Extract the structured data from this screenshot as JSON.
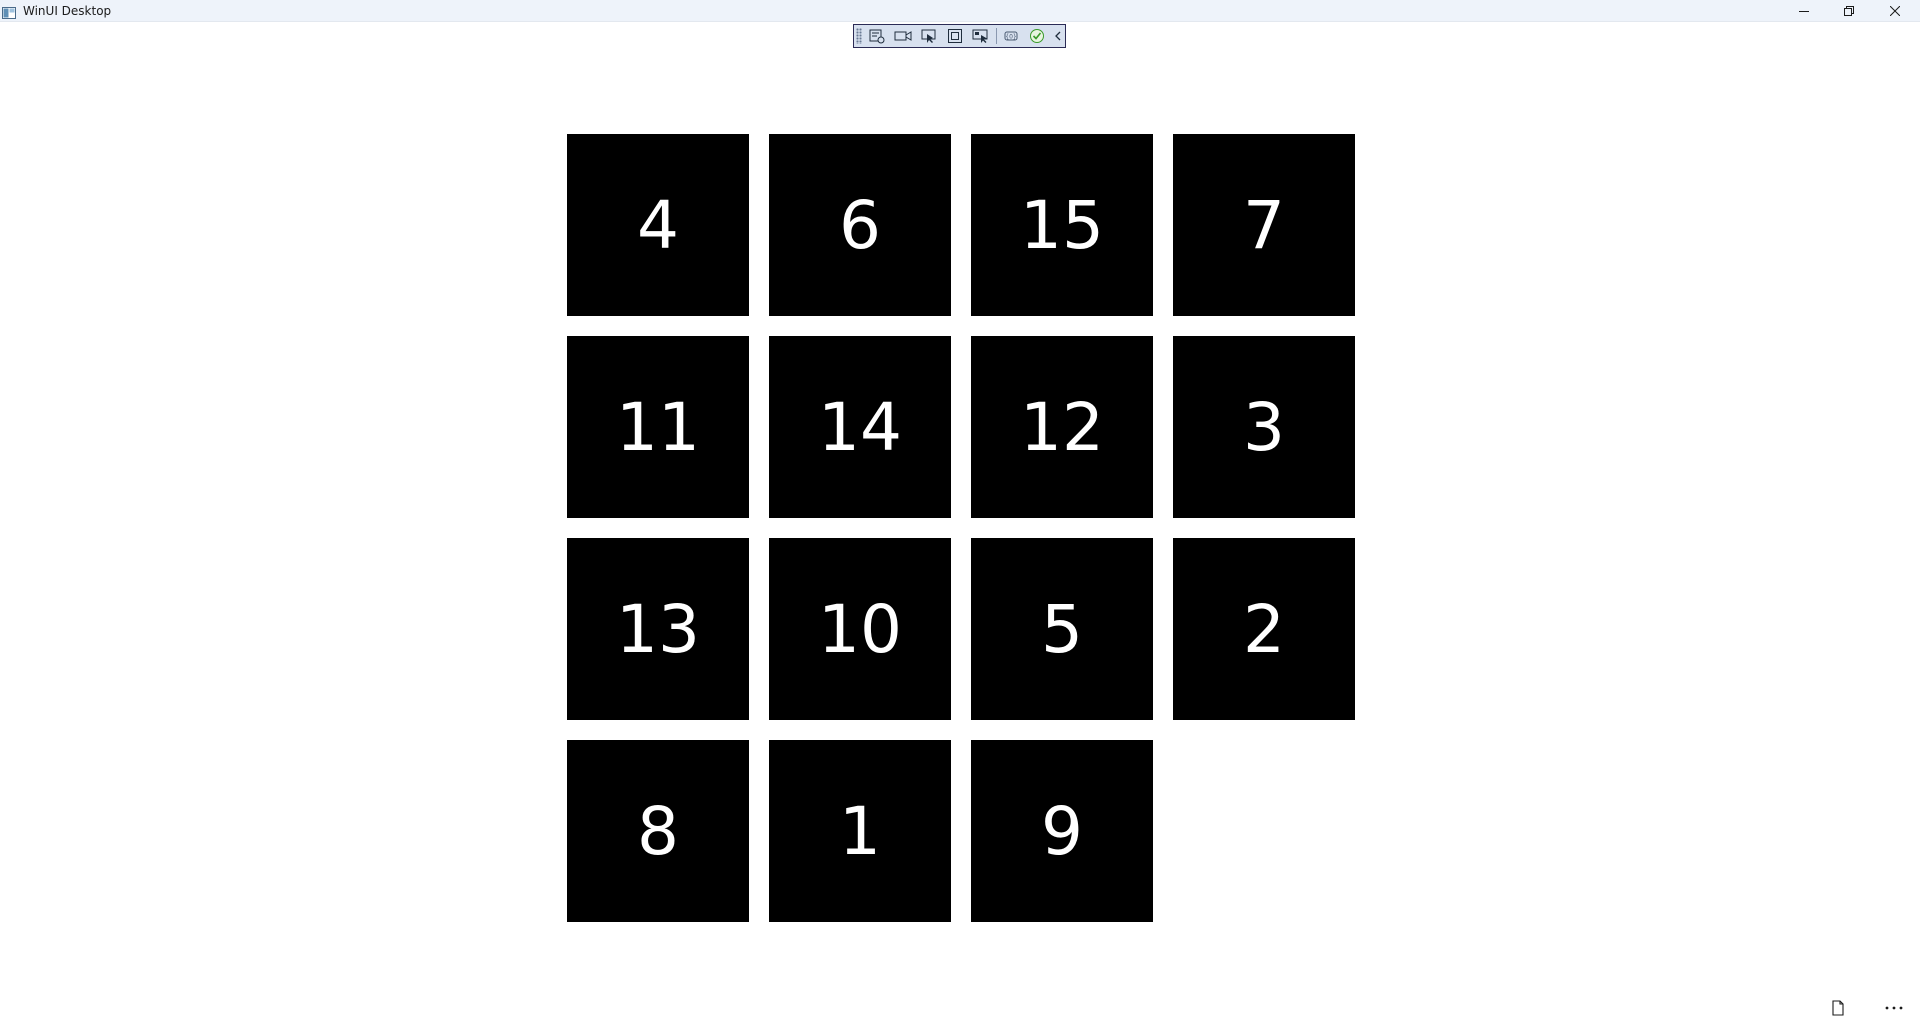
{
  "window": {
    "title": "WinUI Desktop"
  },
  "debug_toolbar": {
    "items": [
      "live-visual-tree-icon",
      "record-icon",
      "select-element-icon",
      "display-layout-adorners-icon",
      "track-focus-icon",
      "binding-failures-icon",
      "hot-reload-status-icon",
      "collapse-chevron-icon"
    ]
  },
  "puzzle": {
    "rows": [
      [
        "4",
        "6",
        "15",
        "7"
      ],
      [
        "11",
        "14",
        "12",
        "3"
      ],
      [
        "13",
        "10",
        "5",
        "2"
      ],
      [
        "8",
        "1",
        "9",
        ""
      ]
    ]
  },
  "colors": {
    "tile_background": "#000000",
    "tile_text": "#ffffff",
    "titlebar_background": "#eef3fa",
    "page_background": "#ffffff"
  }
}
